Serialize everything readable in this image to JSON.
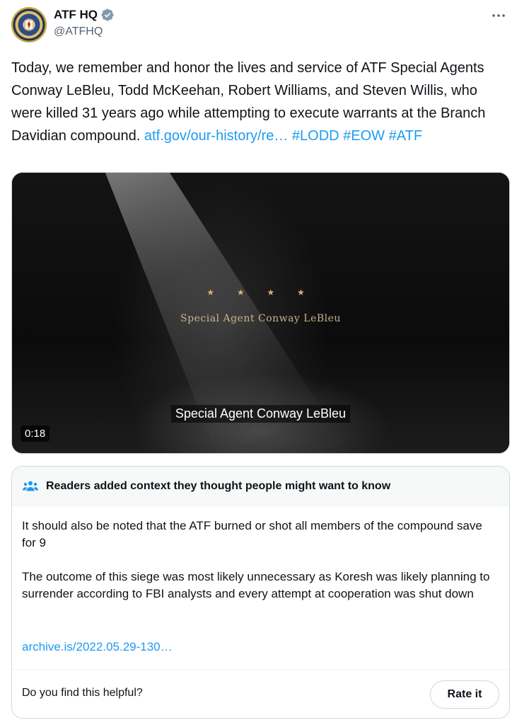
{
  "author": {
    "display_name": "ATF HQ",
    "handle": "@ATFHQ",
    "verified": true
  },
  "more_icon": "ellipsis-icon",
  "tweet": {
    "text_main": "Today, we remember and honor the lives and service of ATF Special Agents Conway LeBleu, Todd McKeehan, Robert Williams, and Steven Willis, who were killed 31 years ago while attempting to execute warrants at the Branch Davidian compound.",
    "link": "atf.gov/our-history/re…",
    "hashtags": [
      "#LODD",
      "#EOW",
      "#ATF"
    ]
  },
  "video": {
    "stars": "★ ★ ★ ★",
    "title_card": "Special Agent Conway LeBleu",
    "caption": "Special Agent Conway LeBleu",
    "duration": "0:18"
  },
  "community_note": {
    "heading": "Readers added context they thought people might want to know",
    "paragraphs": [
      "It should also be noted that the ATF burned or shot all members of the compound save for 9",
      "The outcome of this siege was most likely unnecessary as Koresh was likely planning to surrender according to FBI analysts and every attempt at cooperation was shut down"
    ],
    "link": "archive.is/2022.05.29-130…",
    "helpful_question": "Do you find this helpful?",
    "rate_label": "Rate it"
  },
  "colors": {
    "link": "#1d9bf0",
    "verified_badge": "#829aab",
    "secondary_text": "#536471"
  }
}
